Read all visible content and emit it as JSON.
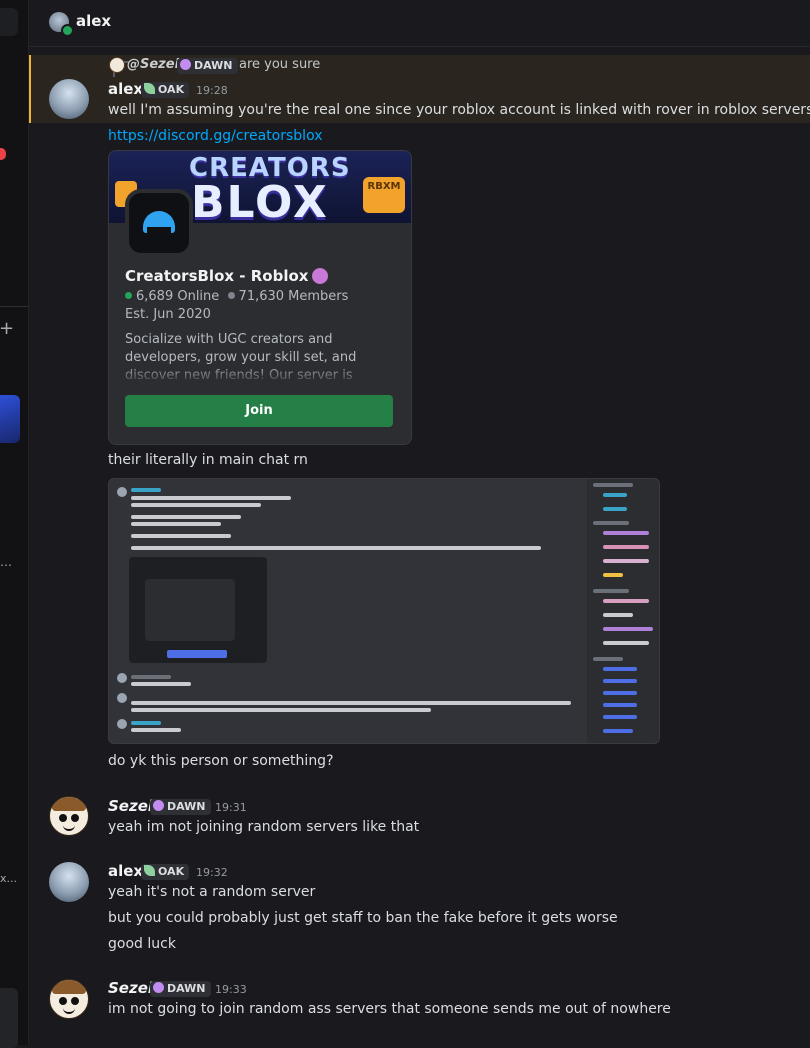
{
  "header": {
    "title": "alex"
  },
  "left_strip": {
    "truncated_text": "x..."
  },
  "reply": {
    "author": "@Sezei",
    "tag": "DAWN",
    "text": "are you sure"
  },
  "messages": [
    {
      "author": "alex",
      "tag": "OAK",
      "time": "19:28",
      "lines": [
        "well I'm assuming you're the real one since your roblox account is linked with rover in roblox servers",
        "https://discord.gg/creatorsblox"
      ]
    }
  ],
  "invite": {
    "banner_title": "CREATORS",
    "banner_sub": "BLOX",
    "banner_badge": "RBXM",
    "name": "CreatorsBlox - Roblox",
    "online": "6,689 Online",
    "members": "71,630 Members",
    "established": "Est. Jun 2020",
    "description": "Socialize with UGC creators and developers, grow your skill set, and discover new friends! Our server is focused around Roblox UGC",
    "join_label": "Join"
  },
  "followups": {
    "line1": "their literally in main chat rn",
    "line2": "do yk this person or something?"
  },
  "group2": {
    "author": "Sezei",
    "tag": "DAWN",
    "time": "19:31",
    "text": "yeah im not joining random servers like that"
  },
  "group3": {
    "author": "alex",
    "tag": "OAK",
    "time": "19:32",
    "lines": [
      "yeah it's not a random server",
      "but you could probably just get staff to ban the fake before it gets worse",
      "good luck"
    ]
  },
  "group4": {
    "author": "Sezei",
    "tag": "DAWN",
    "time": "19:33",
    "text": "im not going to join random ass servers that someone sends me out of nowhere"
  },
  "colors": {
    "accent_link": "#00a8fc",
    "join_button": "#248046",
    "online": "#23a55a",
    "highlight_border": "#f0b232"
  },
  "icons": {
    "oak_tag": "leaf-icon",
    "dawn_tag": "moon-icon",
    "verified": "verified-badge-icon"
  }
}
